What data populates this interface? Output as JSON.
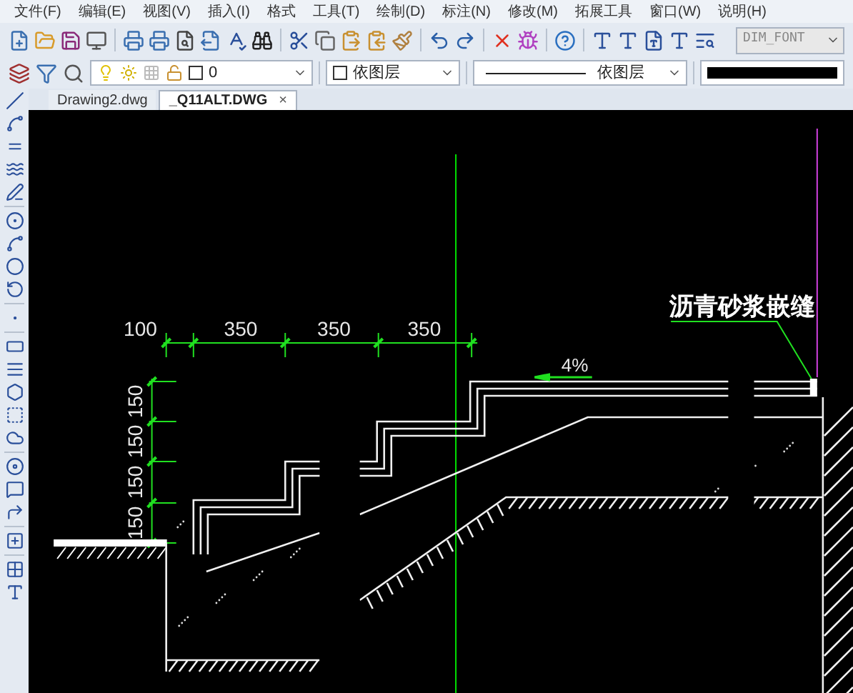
{
  "menu": [
    "文件(F)",
    "编辑(E)",
    "视图(V)",
    "插入(I)",
    "格式",
    "工具(T)",
    "绘制(D)",
    "标注(N)",
    "修改(M)",
    "拓展工具",
    "窗口(W)",
    "说明(H)"
  ],
  "toolbar": {
    "text_style": "DIM_FONT"
  },
  "properties_bar": {
    "layer": "0",
    "color_setting": "依图层",
    "linetype": "依图层"
  },
  "tabs": [
    {
      "label": "Drawing2.dwg",
      "selected": false
    },
    {
      "label": "_Q11ALT.DWG",
      "selected": true,
      "close": "×"
    }
  ],
  "drawing": {
    "horizontal_dimensions": [
      "100",
      "350",
      "350",
      "350"
    ],
    "vertical_dimensions": [
      "150",
      "150",
      "150",
      "150"
    ],
    "slope": "4%",
    "callout": "沥青砂浆嵌缝"
  }
}
